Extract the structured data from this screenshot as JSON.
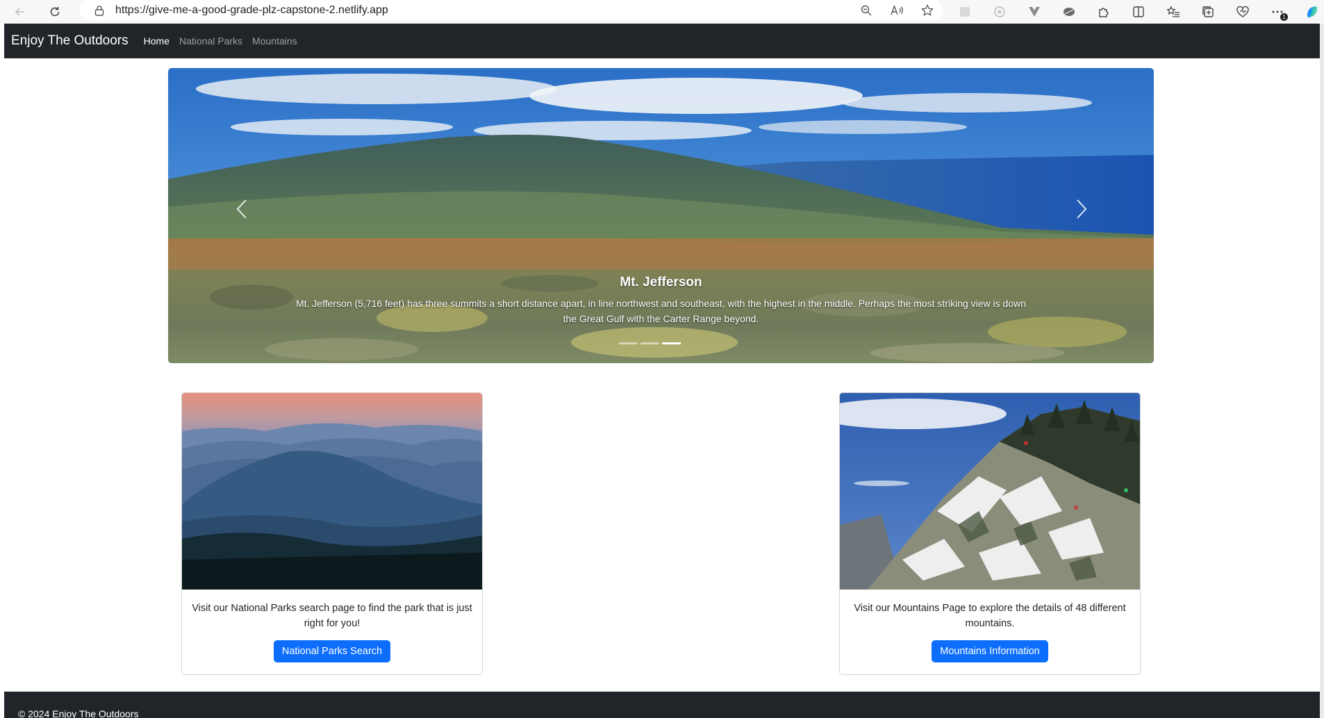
{
  "browser": {
    "url": "https://give-me-a-good-grade-plz-capstone-2.netlify.app",
    "badge_count": "1"
  },
  "navbar": {
    "brand": "Enjoy The Outdoors",
    "links": [
      {
        "label": "Home",
        "active": true
      },
      {
        "label": "National Parks",
        "active": false
      },
      {
        "label": "Mountains",
        "active": false
      }
    ]
  },
  "carousel": {
    "title": "Mt. Jefferson",
    "text": "Mt. Jefferson (5,716 feet) has three summits a short distance apart, in line northwest and southeast, with the highest in the middle. Perhaps the most striking view is down the Great Gulf with the Carter Range beyond.",
    "active_index": 2,
    "slide_count": 3
  },
  "cards": [
    {
      "text": "Visit our National Parks search page to find the park that is just right for you!",
      "button": "National Parks Search"
    },
    {
      "text": "Visit our Mountains Page to explore the details of 48 different mountains.",
      "button": "Mountains Information"
    }
  ],
  "footer": {
    "text": "© 2024 Enjoy The Outdoors"
  },
  "colors": {
    "navbar_bg": "#212529",
    "primary_button": "#0d6efd"
  }
}
